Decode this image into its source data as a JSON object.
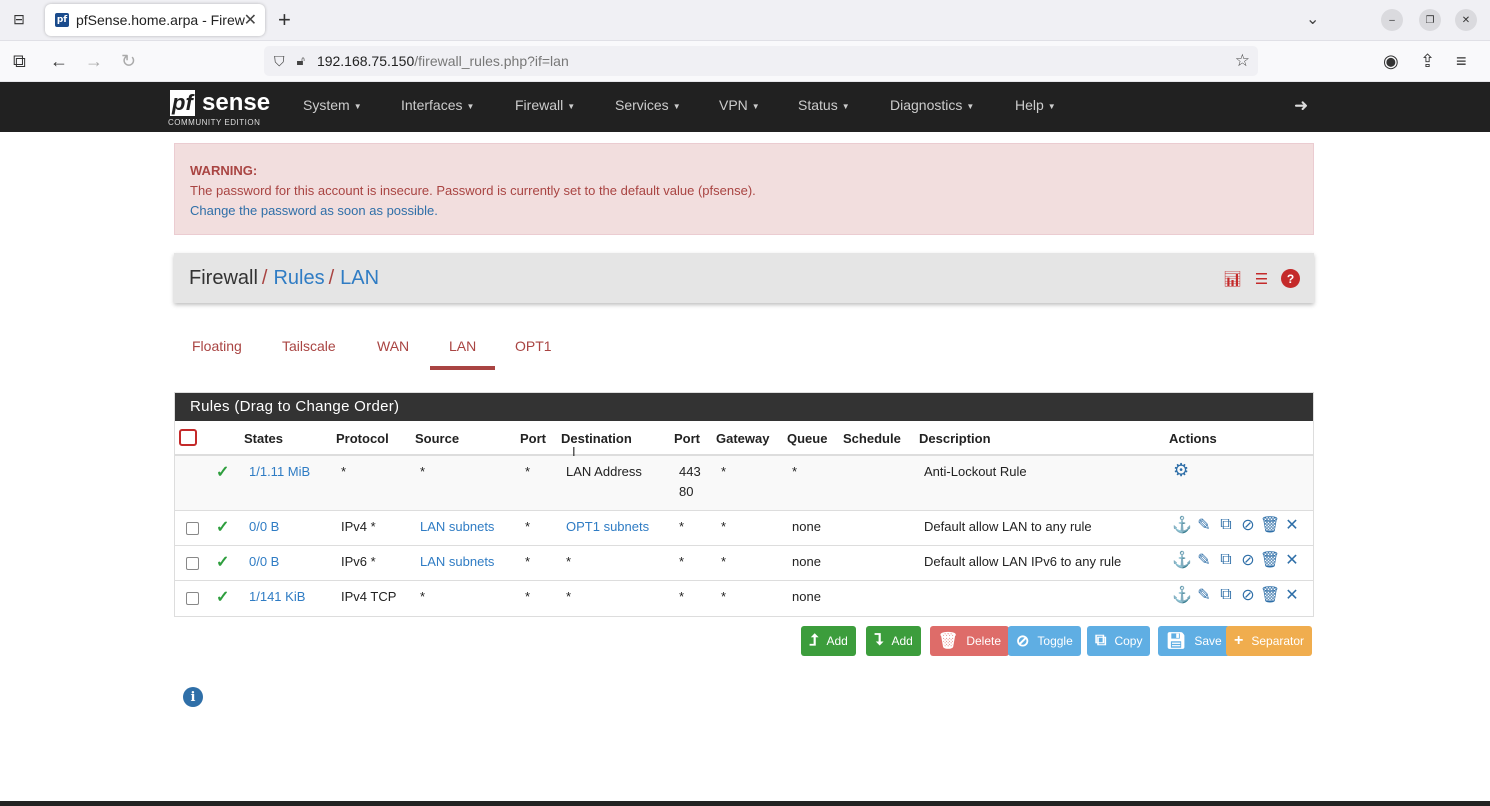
{
  "browser": {
    "tab_title": "pfSense.home.arpa - Firew",
    "url_main": "192.168.75.150",
    "url_path": "/firewall_rules.php?if=lan"
  },
  "nav": {
    "logo_pf": "pf",
    "logo_sense": "sense",
    "logo_edition": "COMMUNITY EDITION",
    "menu": [
      "System",
      "Interfaces",
      "Firewall",
      "Services",
      "VPN",
      "Status",
      "Diagnostics",
      "Help"
    ]
  },
  "warning": {
    "heading": "WARNING:",
    "message": "The password for this account is insecure. Password is currently set to the default value (pfsense).",
    "link": "Change the password as soon as possible."
  },
  "breadcrumb": {
    "part1": "Firewall",
    "part2": "Rules",
    "part3": "LAN"
  },
  "tabs": [
    "Floating",
    "Tailscale",
    "WAN",
    "LAN",
    "OPT1"
  ],
  "rules_panel": {
    "title": "Rules (Drag to Change Order)",
    "headers": [
      "States",
      "Protocol",
      "Source",
      "Port",
      "Destination",
      "Port",
      "Gateway",
      "Queue",
      "Schedule",
      "Description",
      "Actions"
    ],
    "rows": [
      {
        "states": "1/1.11 MiB",
        "protocol": "*",
        "source": "*",
        "sport": "*",
        "destination": "LAN Address",
        "dport1": "443",
        "dport2": "80",
        "gateway": "*",
        "queue": "*",
        "schedule": "",
        "description": "Anti-Lockout Rule"
      },
      {
        "states": "0/0 B",
        "protocol": "IPv4 *",
        "source": "LAN subnets",
        "sport": "*",
        "destination": "OPT1 subnets",
        "dport1": "*",
        "dport2": "",
        "gateway": "*",
        "queue": "none",
        "schedule": "",
        "description": "Default allow LAN to any rule"
      },
      {
        "states": "0/0 B",
        "protocol": "IPv6 *",
        "source": "LAN subnets",
        "sport": "*",
        "destination": "*",
        "dport1": "*",
        "dport2": "",
        "gateway": "*",
        "queue": "none",
        "schedule": "",
        "description": "Default allow LAN IPv6 to any rule"
      },
      {
        "states": "1/141 KiB",
        "protocol": "IPv4 TCP",
        "source": "*",
        "sport": "*",
        "destination": "*",
        "dport1": "*",
        "dport2": "",
        "gateway": "*",
        "queue": "none",
        "schedule": "",
        "description": ""
      }
    ]
  },
  "buttons": {
    "add_top": "Add",
    "add_bottom": "Add",
    "delete": "Delete",
    "toggle": "Toggle",
    "copy": "Copy",
    "save": "Save",
    "separator": "Separator"
  },
  "colors": {
    "accent_red": "#a94442",
    "link_blue": "#2f7cc4",
    "nav_bg": "#212121"
  }
}
